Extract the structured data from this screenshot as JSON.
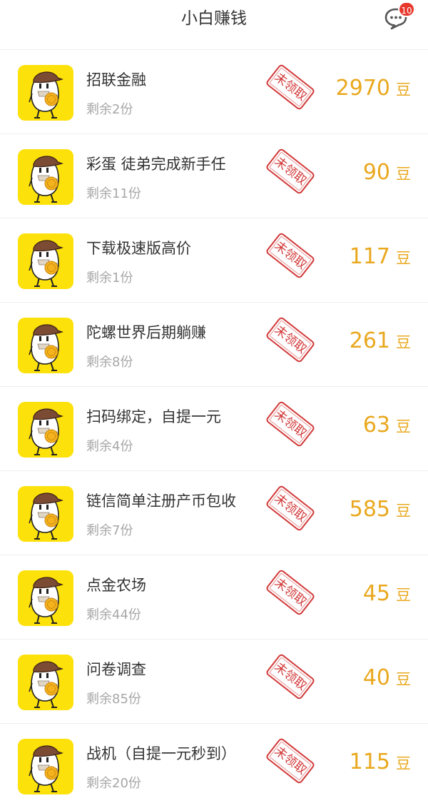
{
  "header": {
    "title": "小白赚钱",
    "message_badge": "10",
    "message_icon": "chat-bubble-icon"
  },
  "colors": {
    "reward": "#e9a81e",
    "stamp": "#d23a3a",
    "icon_bg": "#fde10b",
    "badge": "#e8372b"
  },
  "tasks": [
    {
      "title": "招联金融",
      "remaining": "剩余2份",
      "stamp": "未领取",
      "amount": "2970",
      "unit": "豆"
    },
    {
      "title": "彩蛋 徒弟完成新手任",
      "remaining": "剩余11份",
      "stamp": "未领取",
      "amount": "90",
      "unit": "豆"
    },
    {
      "title": "下载极速版高价",
      "remaining": "剩余1份",
      "stamp": "未领取",
      "amount": "117",
      "unit": "豆"
    },
    {
      "title": "陀螺世界后期躺赚",
      "remaining": "剩余8份",
      "stamp": "未领取",
      "amount": "261",
      "unit": "豆"
    },
    {
      "title": "扫码绑定，自提一元",
      "remaining": "剩余4份",
      "stamp": "未领取",
      "amount": "63",
      "unit": "豆"
    },
    {
      "title": "链信简单注册产币包收",
      "remaining": "剩余7份",
      "stamp": "未领取",
      "amount": "585",
      "unit": "豆"
    },
    {
      "title": "点金农场",
      "remaining": "剩余44份",
      "stamp": "未领取",
      "amount": "45",
      "unit": "豆"
    },
    {
      "title": "问卷调查",
      "remaining": "剩余85份",
      "stamp": "未领取",
      "amount": "40",
      "unit": "豆"
    },
    {
      "title": "战机（自提一元秒到）",
      "remaining": "剩余20份",
      "stamp": "未领取",
      "amount": "115",
      "unit": "豆"
    }
  ]
}
